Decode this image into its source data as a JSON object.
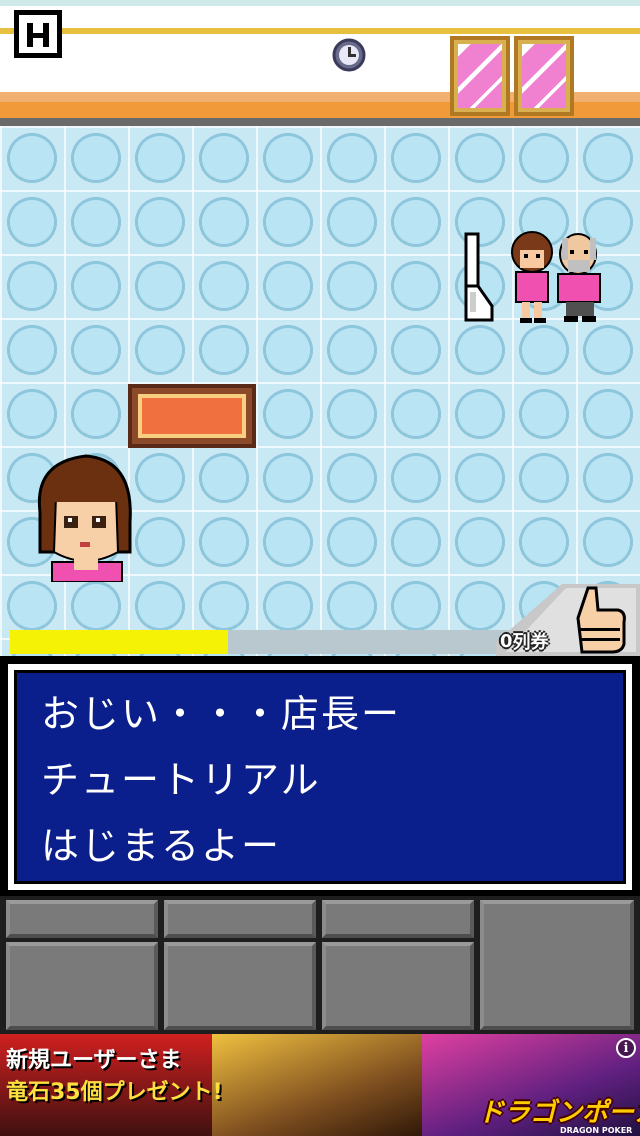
{
  "header": {
    "pause_label": "pause",
    "clock_icon": "clock-icon"
  },
  "progress": {
    "fraction": 0.39
  },
  "like": {
    "ticket_count": "0",
    "ticket_suffix": "列券",
    "icon": "thumbs-up-icon"
  },
  "dialog": {
    "lines": [
      "おじい・・・店長ー",
      "チュートリアル",
      "はじまるよー"
    ]
  },
  "ad": {
    "headline1": "新規ユーザーさま",
    "headline2": "竜石35個プレゼント!",
    "logo": "ドラゴンポーカー",
    "logo_sub": "DRAGON POKER",
    "info_icon": "i"
  },
  "colors": {
    "dialog_bg": "#0b1f8c",
    "progress_fill": "#f6f206",
    "progress_track": "#b9c7cf",
    "floor": "#a8d4e8"
  }
}
